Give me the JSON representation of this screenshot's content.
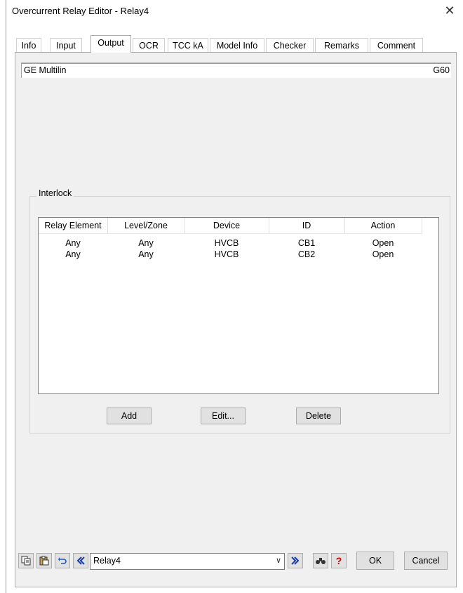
{
  "window": {
    "title": "Overcurrent Relay Editor - Relay4",
    "close": "✕"
  },
  "tabs": [
    {
      "label": "Info"
    },
    {
      "label": "Input"
    },
    {
      "label": "Output"
    },
    {
      "label": "OCR"
    },
    {
      "label": "TCC kA"
    },
    {
      "label": "Model Info"
    },
    {
      "label": "Checker"
    },
    {
      "label": "Remarks"
    },
    {
      "label": "Comment"
    }
  ],
  "active_tab": "Output",
  "vendor": {
    "manufacturer": "GE Multilin",
    "model": "G60"
  },
  "interlock": {
    "label": "Interlock",
    "columns": [
      "Relay Element",
      "Level/Zone",
      "Device",
      "ID",
      "Action"
    ],
    "rows": [
      [
        "Any",
        "Any",
        "HVCB",
        "CB1",
        "Open"
      ],
      [
        "Any",
        "Any",
        "HVCB",
        "CB2",
        "Open"
      ]
    ],
    "buttons": {
      "add": "Add",
      "edit": "Edit...",
      "delete": "Delete"
    }
  },
  "footer": {
    "relay_select": "Relay4",
    "ok": "OK",
    "cancel": "Cancel",
    "icons": [
      "copy-icon",
      "paste-icon",
      "undo-icon",
      "previous-icon",
      "next-icon",
      "find-icon",
      "help-icon"
    ]
  }
}
